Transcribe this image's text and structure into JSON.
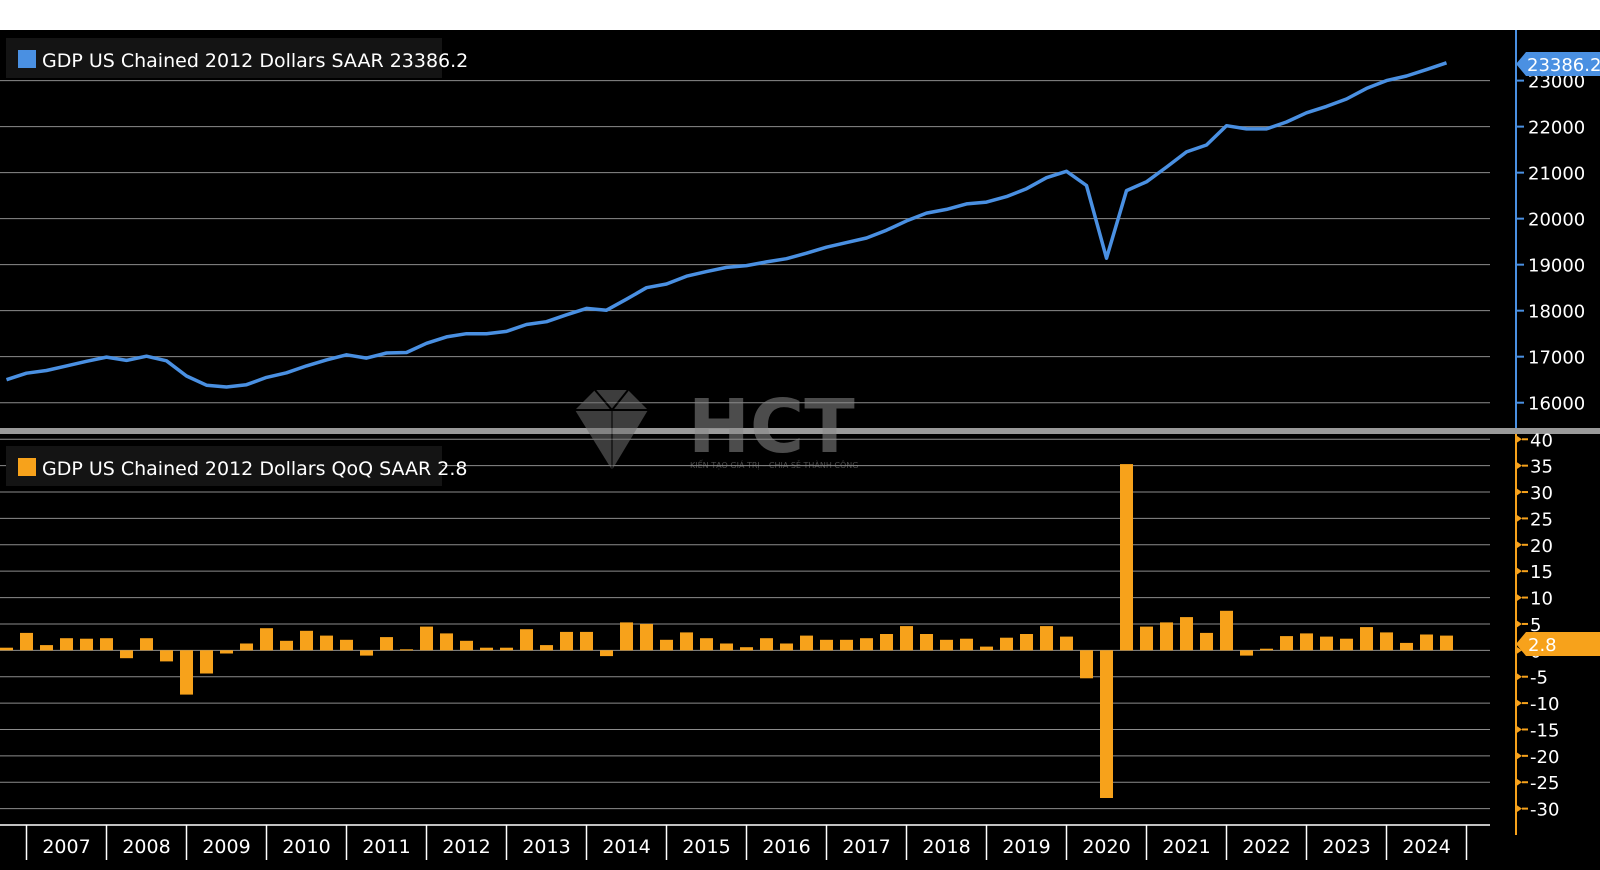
{
  "watermark": {
    "brand": "HCT",
    "tagline": "KIẾN TẠO GIÁ TRỊ – CHIA SẺ THÀNH CÔNG"
  },
  "colors": {
    "background": "#000000",
    "line": "#4a90e2",
    "bar": "#f7a21b",
    "grid": "#8c8c8c",
    "axis_level": "#4a90e2",
    "axis_growth": "#f7a21b"
  },
  "chart_data": [
    {
      "type": "line",
      "legend": "GDP US Chained 2012 Dollars SAAR 23386.2",
      "last_value_label": "23386.2",
      "yticks": [
        16000,
        17000,
        18000,
        19000,
        20000,
        21000,
        22000,
        23000
      ],
      "ylim": [
        15450,
        24100
      ],
      "grid": true,
      "x_start_year": 2007,
      "values": [
        16500,
        16640,
        16700,
        16800,
        16900,
        16990,
        16920,
        17010,
        16910,
        16580,
        16380,
        16340,
        16390,
        16550,
        16650,
        16800,
        16930,
        17040,
        16970,
        17080,
        17090,
        17290,
        17430,
        17500,
        17500,
        17550,
        17700,
        17760,
        17910,
        18050,
        18010,
        18250,
        18500,
        18580,
        18750,
        18850,
        18940,
        18980,
        19060,
        19130,
        19250,
        19380,
        19480,
        19580,
        19750,
        19950,
        20120,
        20200,
        20320,
        20360,
        20480,
        20650,
        20890,
        21030,
        20720,
        19140,
        20610,
        20800,
        21120,
        21450,
        21600,
        22020,
        21950,
        21950,
        22100,
        22300,
        22440,
        22600,
        22830,
        23000,
        23100,
        23240,
        23386.2
      ]
    },
    {
      "type": "bar",
      "legend": "GDP US Chained 2012 Dollars QoQ SAAR 2.8",
      "last_value_label": "2.8",
      "yticks": [
        -30,
        -25,
        -20,
        -15,
        -10,
        -5,
        0,
        5,
        10,
        15,
        20,
        25,
        30,
        35,
        40
      ],
      "ylim": [
        -35,
        41
      ],
      "grid": true,
      "values": [
        0.5,
        3.3,
        1.0,
        2.3,
        2.2,
        2.3,
        -1.5,
        2.3,
        -2.1,
        -8.4,
        -4.4,
        -0.6,
        1.3,
        4.2,
        1.8,
        3.7,
        2.8,
        2.0,
        -1.0,
        2.5,
        0.2,
        4.5,
        3.2,
        1.8,
        0.5,
        0.5,
        4.0,
        1.0,
        3.5,
        3.5,
        -1.1,
        5.3,
        5.0,
        2.0,
        3.4,
        2.3,
        1.3,
        0.6,
        2.3,
        1.3,
        2.8,
        2.0,
        2.0,
        2.3,
        3.1,
        4.6,
        3.1,
        2.0,
        2.2,
        0.7,
        2.4,
        3.1,
        4.6,
        2.6,
        -5.3,
        -28.0,
        35.3,
        4.5,
        5.3,
        6.3,
        3.3,
        7.5,
        -1.0,
        0.3,
        2.7,
        3.2,
        2.6,
        2.2,
        4.4,
        3.4,
        1.4,
        3.0,
        2.8
      ]
    }
  ],
  "x_axis": {
    "years": [
      "2007",
      "2008",
      "2009",
      "2010",
      "2011",
      "2012",
      "2013",
      "2014",
      "2015",
      "2016",
      "2017",
      "2018",
      "2019",
      "2020",
      "2021",
      "2022",
      "2023",
      "2024"
    ]
  }
}
